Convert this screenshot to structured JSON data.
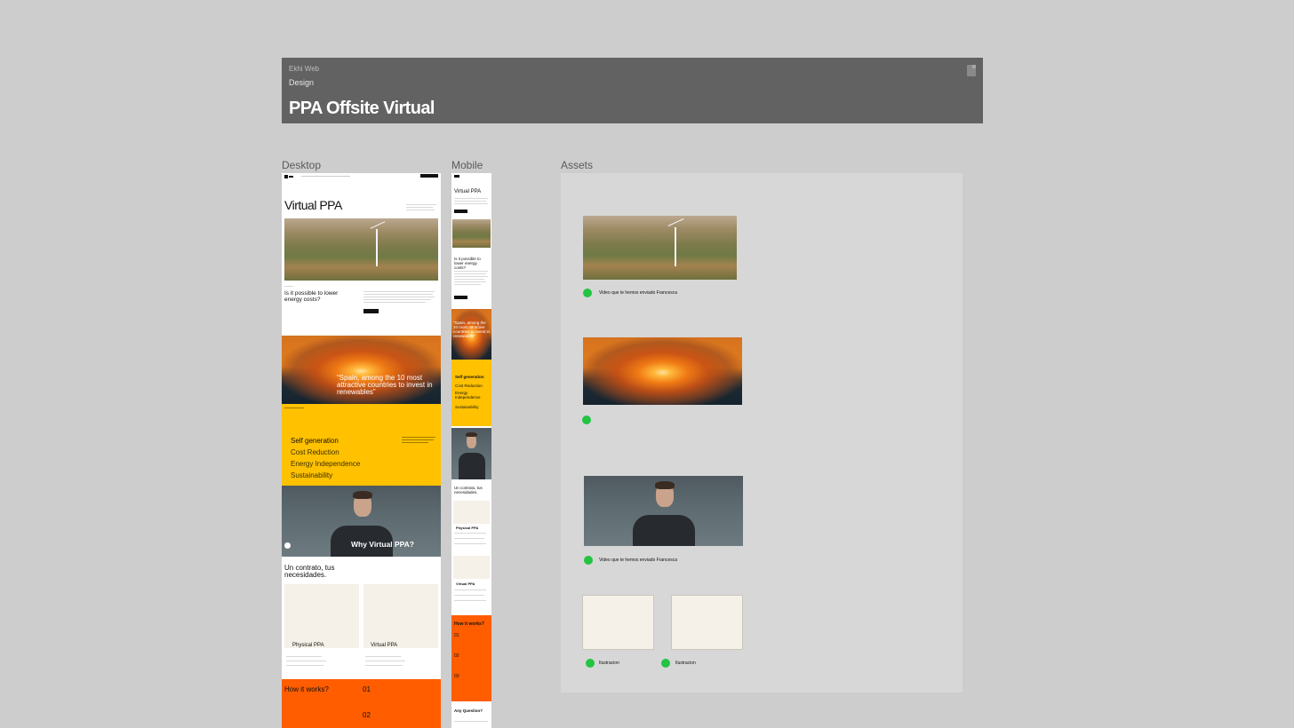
{
  "header": {
    "project": "Ekhi Web",
    "section": "Design",
    "title": "PPA Offsite Virtual",
    "icon": "document-icon"
  },
  "frames": {
    "desktop_label": "Desktop",
    "mobile_label": "Mobile",
    "assets_label": "Assets"
  },
  "desktop": {
    "hero_title": "Virtual PPA",
    "intro_question": "Is it possible to lower energy costs?",
    "quote": "“Spain, among the 10 most attractive countries to invest in renewables”",
    "benefits": [
      "Self generation",
      "Cost Reduction",
      "Energy Independence",
      "Sustainability"
    ],
    "video_title": "Why Virtual PPA?",
    "contract_title": "Un contrato, tus necesidades.",
    "card_physical": "Physical PPA",
    "card_virtual": "Virtual PPA",
    "how_title": "How it works?",
    "step_1": "01",
    "step_2": "02"
  },
  "mobile": {
    "hero_title": "Virtual PPA",
    "question": "Is it possible to lower energy costs?",
    "quote": "“Spain, among the 10 most attractive countries to invest in renewables”",
    "benefits": [
      "Self generation",
      "Cost Reduction",
      "Energy Independence",
      "Sustainability"
    ],
    "contract_title": "Un contrato, tus necesidades.",
    "card_physical": "Physical PPA",
    "card_virtual": "Virtual PPA",
    "how_title": "How it works?",
    "steps": [
      "01",
      "02",
      "03"
    ],
    "faq_title": "Any Question?"
  },
  "assets": {
    "items": [
      {
        "caption": "Video que te hemos enviado Francesca"
      },
      {
        "caption": ""
      },
      {
        "caption": "Video que te hemos enviado Francesca"
      },
      {
        "caption": "Ilustracion"
      },
      {
        "caption": "Ilustracion"
      }
    ]
  },
  "colors": {
    "canvas": "#cdcdcd",
    "header": "#626262",
    "yellow": "#ffc100",
    "orange": "#ff5d00",
    "status_green": "#23c343"
  }
}
